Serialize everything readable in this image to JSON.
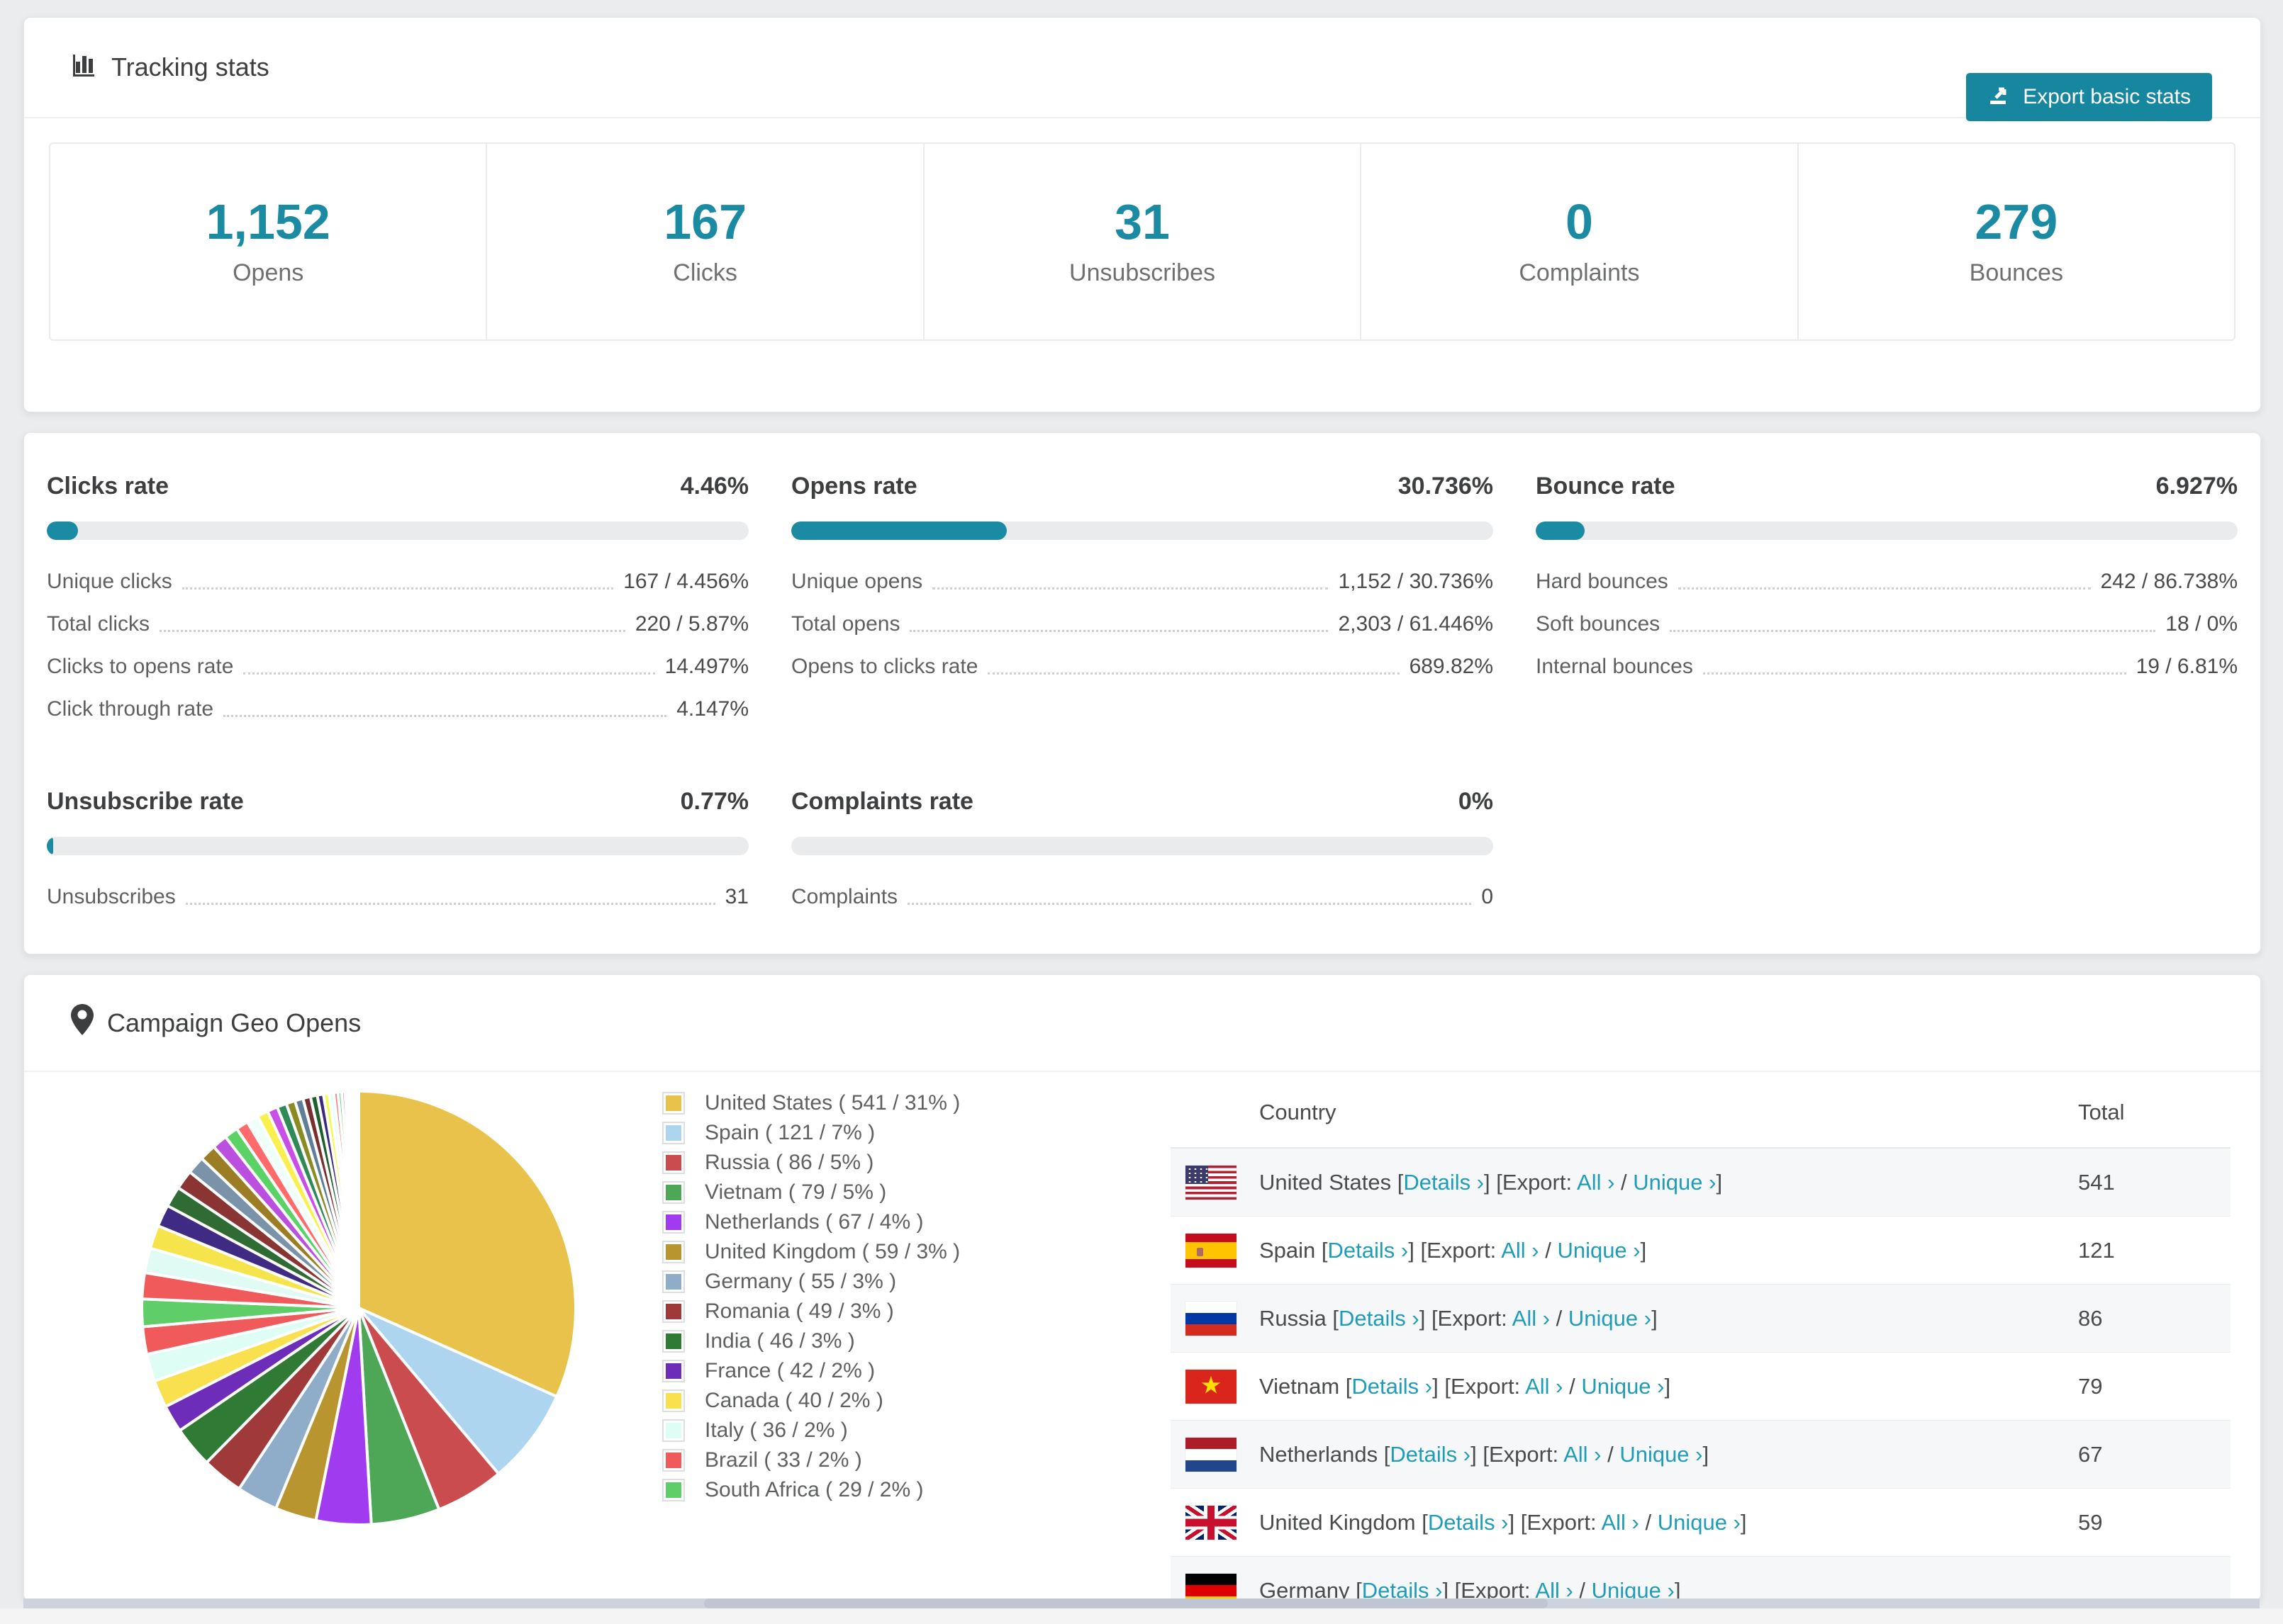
{
  "accent": "#1b8ba4",
  "link_color": "#1f9db8",
  "header": {
    "title": "Tracking stats",
    "export_button": "Export basic stats"
  },
  "summary": [
    {
      "value": "1,152",
      "label": "Opens"
    },
    {
      "value": "167",
      "label": "Clicks"
    },
    {
      "value": "31",
      "label": "Unsubscribes"
    },
    {
      "value": "0",
      "label": "Complaints"
    },
    {
      "value": "279",
      "label": "Bounces"
    }
  ],
  "rates": [
    {
      "title": "Clicks rate",
      "value": "4.46%",
      "percent": 4.46,
      "rows": [
        {
          "label": "Unique clicks",
          "value": "167 / 4.456%"
        },
        {
          "label": "Total clicks",
          "value": "220 / 5.87%"
        },
        {
          "label": "Clicks to opens rate",
          "value": "14.497%"
        },
        {
          "label": "Click through rate",
          "value": "4.147%"
        }
      ]
    },
    {
      "title": "Opens rate",
      "value": "30.736%",
      "percent": 30.736,
      "rows": [
        {
          "label": "Unique opens",
          "value": "1,152 / 30.736%"
        },
        {
          "label": "Total opens",
          "value": "2,303 / 61.446%"
        },
        {
          "label": "Opens to clicks rate",
          "value": "689.82%"
        }
      ]
    },
    {
      "title": "Bounce rate",
      "value": "6.927%",
      "percent": 6.927,
      "rows": [
        {
          "label": "Hard bounces",
          "value": "242 / 86.738%"
        },
        {
          "label": "Soft bounces",
          "value": "18 / 0%"
        },
        {
          "label": "Internal bounces",
          "value": "19 / 6.81%"
        }
      ]
    },
    {
      "title": "Unsubscribe rate",
      "value": "0.77%",
      "percent": 0.77,
      "rows": [
        {
          "label": "Unsubscribes",
          "value": "31"
        }
      ]
    },
    {
      "title": "Complaints rate",
      "value": "0%",
      "percent": 0,
      "rows": [
        {
          "label": "Complaints",
          "value": "0"
        }
      ]
    }
  ],
  "geo": {
    "title": "Campaign Geo Opens",
    "chart_data": {
      "type": "pie",
      "start_angle_deg": 0,
      "direction": "clockwise",
      "legend_position": "right",
      "slices": [
        {
          "label": "United States",
          "count": 541,
          "pct": 31,
          "color": "#E8C24A"
        },
        {
          "label": "Spain",
          "count": 121,
          "pct": 7,
          "color": "#AED5F0"
        },
        {
          "label": "Russia",
          "count": 86,
          "pct": 5,
          "color": "#CB4C4F"
        },
        {
          "label": "Vietnam",
          "count": 79,
          "pct": 5,
          "color": "#4EA757"
        },
        {
          "label": "Netherlands",
          "count": 67,
          "pct": 4,
          "color": "#A13BEF"
        },
        {
          "label": "United Kingdom",
          "count": 59,
          "pct": 3,
          "color": "#B9952F"
        },
        {
          "label": "Germany",
          "count": 55,
          "pct": 3,
          "color": "#8FACC8"
        },
        {
          "label": "Romania",
          "count": 49,
          "pct": 3,
          "color": "#A03A3A"
        },
        {
          "label": "India",
          "count": 46,
          "pct": 3,
          "color": "#2F7A35"
        },
        {
          "label": "France",
          "count": 42,
          "pct": 2,
          "color": "#6D2DB8"
        },
        {
          "label": "Canada",
          "count": 40,
          "pct": 2,
          "color": "#F8E04F"
        },
        {
          "label": "Italy",
          "count": 36,
          "pct": 2,
          "color": "#DDFDF5"
        },
        {
          "label": "Brazil",
          "count": 33,
          "pct": 2,
          "color": "#F05A5A"
        },
        {
          "label": "South Africa",
          "count": 29,
          "pct": 2,
          "color": "#5FCE69"
        }
      ],
      "other_slices": [
        {
          "pct": 1.9,
          "color": "#F05A5A"
        },
        {
          "pct": 1.8,
          "color": "#DFFBF3"
        },
        {
          "pct": 1.7,
          "color": "#F6E44C"
        },
        {
          "pct": 1.6,
          "color": "#3F2A84"
        },
        {
          "pct": 1.5,
          "color": "#2F6B33"
        },
        {
          "pct": 1.4,
          "color": "#8A3434"
        },
        {
          "pct": 1.3,
          "color": "#7B93A8"
        },
        {
          "pct": 1.2,
          "color": "#9A7D24"
        },
        {
          "pct": 1.1,
          "color": "#BB4FE0"
        },
        {
          "pct": 1.0,
          "color": "#5BD266"
        },
        {
          "pct": 0.9,
          "color": "#FF6B6B"
        },
        {
          "pct": 0.85,
          "color": "#EFFFFA"
        },
        {
          "pct": 0.8,
          "color": "#F9F04E"
        },
        {
          "pct": 0.75,
          "color": "#C94FE8"
        },
        {
          "pct": 0.7,
          "color": "#2E8B57"
        },
        {
          "pct": 0.65,
          "color": "#8B8B23"
        },
        {
          "pct": 0.6,
          "color": "#5F7F99"
        },
        {
          "pct": 0.55,
          "color": "#7A2E2E"
        },
        {
          "pct": 0.5,
          "color": "#1F5F2A"
        },
        {
          "pct": 0.45,
          "color": "#3A2A7E"
        },
        {
          "pct": 0.4,
          "color": "#F3F94E"
        },
        {
          "pct": 0.35,
          "color": "#E6FFF8"
        },
        {
          "pct": 0.3,
          "color": "#FF7B7B"
        },
        {
          "pct": 0.27,
          "color": "#66DD77"
        },
        {
          "pct": 0.24,
          "color": "#DD66EE"
        },
        {
          "pct": 0.21,
          "color": "#AA8822"
        },
        {
          "pct": 0.18,
          "color": "#88AACC"
        },
        {
          "pct": 0.15,
          "color": "#993333"
        },
        {
          "pct": 0.12,
          "color": "#227733"
        },
        {
          "pct": 0.1,
          "color": "#5533AA"
        },
        {
          "pct": 0.08,
          "color": "#EEDD44"
        },
        {
          "pct": 0.06,
          "color": "#CCF5EE"
        },
        {
          "pct": 0.05,
          "color": "#EE6666"
        },
        {
          "pct": 0.04,
          "color": "#55CC66"
        }
      ]
    },
    "table": {
      "columns": [
        "Country",
        "Total"
      ],
      "link_labels": {
        "details": "Details",
        "export_prefix": "[Export:",
        "all": "All",
        "unique": "Unique",
        "chevron": "›"
      },
      "rows": [
        {
          "country": "United States",
          "flag": "us",
          "total": "541"
        },
        {
          "country": "Spain",
          "flag": "es",
          "total": "121"
        },
        {
          "country": "Russia",
          "flag": "ru",
          "total": "86"
        },
        {
          "country": "Vietnam",
          "flag": "vn",
          "total": "79"
        },
        {
          "country": "Netherlands",
          "flag": "nl",
          "total": "67"
        },
        {
          "country": "United Kingdom",
          "flag": "gb",
          "total": "59"
        },
        {
          "country": "Germany",
          "flag": "de",
          "total": ""
        }
      ]
    }
  }
}
